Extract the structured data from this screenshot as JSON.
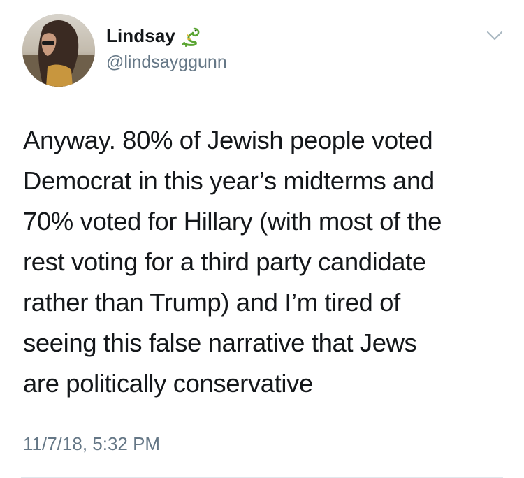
{
  "user": {
    "display_name": "Lindsay",
    "handle": "@lindsayggunn",
    "name_emoji": "dragon-icon"
  },
  "tweet": {
    "text_lines": [
      "Anyway. 80% of Jewish people voted",
      "Democrat in this year’s midterms and",
      "70% voted for Hillary (with most of the",
      "rest voting for a third party candidate",
      "rather than Trump) and I’m tired of",
      "seeing this false narrative that Jews",
      "are politically conservative"
    ],
    "timestamp": "11/7/18, 5:32 PM"
  },
  "icons": {
    "menu": "chevron-down-icon"
  },
  "colors": {
    "text": "#14171a",
    "secondary": "#657786",
    "divider": "#e1e8ed"
  }
}
